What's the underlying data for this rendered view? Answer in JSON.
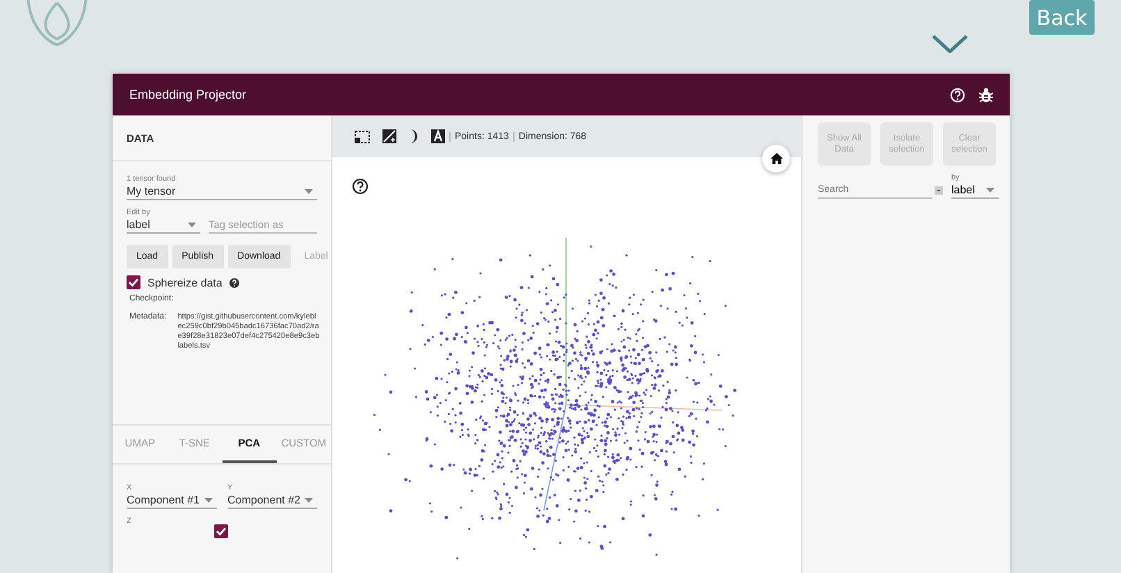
{
  "top_bar": {
    "back_button": "Back"
  },
  "window": {
    "title": "Embedding Projector"
  },
  "data_panel": {
    "heading": "DATA",
    "tensor": {
      "label": "1 tensor found",
      "value": "My tensor"
    },
    "edit_by": {
      "label": "Edit by",
      "value": "label",
      "placeholder": "Tag selection as"
    },
    "buttons": [
      {
        "label": "Load",
        "disabled": false
      },
      {
        "label": "Publish",
        "disabled": false
      },
      {
        "label": "Download",
        "disabled": false
      },
      {
        "label": "Label",
        "disabled": true
      }
    ],
    "sphereize": {
      "label": "Sphereize data",
      "checked": true
    },
    "checkpoint": {
      "label": "Checkpoint:"
    },
    "metadata": {
      "label": "Metadata:",
      "lines": [
        "https://gist.githubusercontent.com/kylebl",
        "ec259c0bf29b045badc16736fac70ad2/ra",
        "e39f28e31823e07def4c275420e8e9c3eb",
        "labels.tsv"
      ]
    },
    "tabs": [
      {
        "label": "UMAP",
        "selected": false
      },
      {
        "label": "T-SNE",
        "selected": false
      },
      {
        "label": "PCA",
        "selected": true
      },
      {
        "label": "CUSTOM",
        "selected": false
      }
    ],
    "components": [
      {
        "label": "X",
        "value": "Component #1"
      },
      {
        "label": "Y",
        "value": "Component #2"
      }
    ],
    "z": {
      "label": "Z",
      "checked": true
    }
  },
  "toolbar": {
    "points": "Points: 1413",
    "dimension": "Dimension: 768"
  },
  "inspector": {
    "buttons": [
      {
        "label": "Show All Data",
        "disabled": true
      },
      {
        "label": "Isolate selection",
        "disabled": true
      },
      {
        "label": "Clear selection",
        "disabled": true
      }
    ],
    "search": {
      "placeholder": "Search"
    },
    "by": {
      "label": "by",
      "value": "label"
    }
  }
}
